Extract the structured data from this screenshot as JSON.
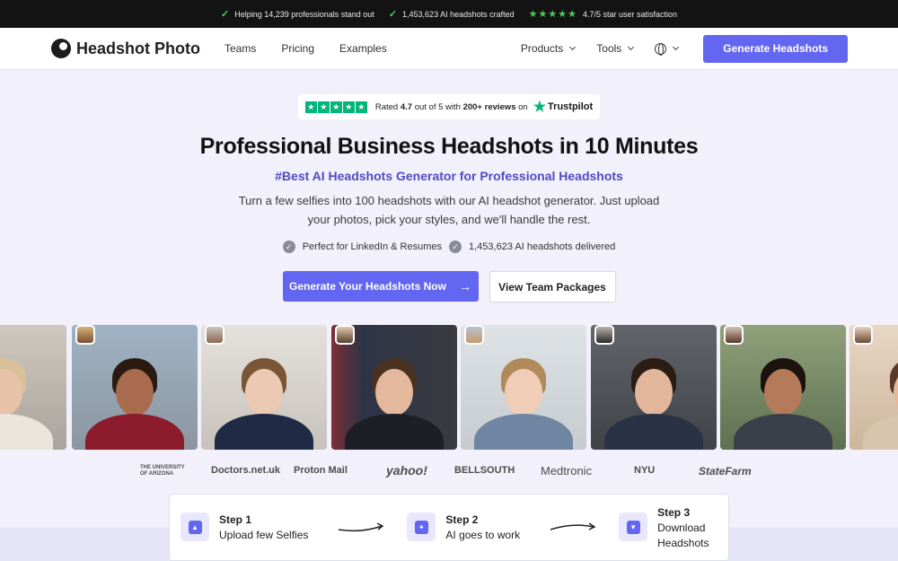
{
  "topbar": {
    "items": [
      {
        "icon": "check-icon",
        "text": "Helping 14,239 professionals stand out"
      },
      {
        "icon": "check-icon",
        "text": "1,453,623 AI headshots crafted"
      },
      {
        "icon": "five-stars-icon",
        "stars": 5,
        "text": "4.7/5 star user satisfaction"
      }
    ]
  },
  "nav": {
    "brand": "Headshot Photo",
    "links": [
      "Teams",
      "Pricing",
      "Examples"
    ],
    "dropdowns": [
      "Products",
      "Tools"
    ],
    "cta": "Generate Headshots"
  },
  "trustpilot": {
    "prefix": "Rated",
    "rating": "4.7",
    "mid": "out of 5 with",
    "reviews": "200+ reviews",
    "suffix": "on",
    "brand": "Trustpilot",
    "stars": 5
  },
  "hero": {
    "title": "Professional Business Headshots in 10 Minutes",
    "subtitle": "#Best AI Headshots Generator for Professional Headshots",
    "description": "Turn a few selfies into 100 headshots with our AI headshot generator. Just upload your photos, pick your styles, and we'll handle the rest.",
    "features": [
      "Perfect for LinkedIn & Resumes",
      "1,453,623 AI headshots delivered"
    ],
    "primary_cta": "Generate Your Headshots Now",
    "secondary_cta": "View Team Packages"
  },
  "logos": [
    "THE UNIVERSITY OF ARIZONA",
    "Doctors.net.uk",
    "Proton Mail",
    "yahoo!",
    "BELLSOUTH",
    "Medtronic",
    "NYU",
    "StateFarm"
  ],
  "steps": [
    {
      "title": "Step 1",
      "text": "Upload few Selfies",
      "icon": "upload-icon"
    },
    {
      "title": "Step 2",
      "text": "AI goes to work",
      "icon": "sparkle-icon"
    },
    {
      "title": "Step 3",
      "text": "Download Headshots",
      "icon": "download-icon"
    }
  ],
  "colors": {
    "accent": "#6366f1",
    "subhead": "#5249c4",
    "trustpilot": "#00b67a",
    "topbar_check": "#4ccd5a"
  }
}
